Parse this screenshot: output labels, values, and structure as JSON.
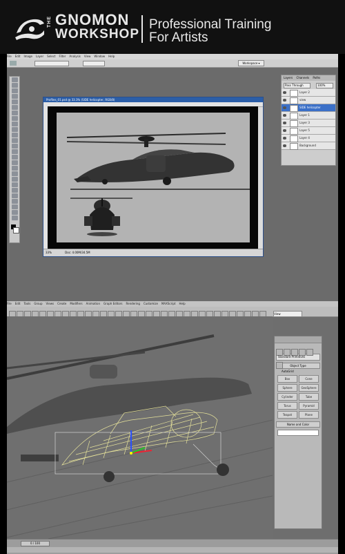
{
  "banner": {
    "logo_the": "THE",
    "logo_line1": "GNOMON",
    "logo_line2": "WORKSHOP",
    "tagline_line1": "Professional Training",
    "tagline_line2": "For Artists"
  },
  "photoshop": {
    "menu": [
      "File",
      "Edit",
      "Image",
      "Layer",
      "Select",
      "Filter",
      "Analysis",
      "View",
      "Window",
      "Help"
    ],
    "workspace_button": "Workspace ▾",
    "document_title": "Profiles_01.psd @ 33.3% (SIDE helicopter, RGB/8)",
    "zoom": "33%",
    "doc_info": "Doc: 4.00M/34.5M",
    "layers_panel": {
      "tabs": [
        "Layers",
        "Channels",
        "Paths"
      ],
      "blend_mode": "Pass Through",
      "opacity": "100%",
      "layers": [
        {
          "name": "Layer 2",
          "selected": false
        },
        {
          "name": "view",
          "selected": false
        },
        {
          "name": "SIDE helicopter",
          "selected": true
        },
        {
          "name": "Layer 1",
          "selected": false
        },
        {
          "name": "Layer 3",
          "selected": false
        },
        {
          "name": "Layer 5",
          "selected": false
        },
        {
          "name": "Layer 4",
          "selected": false
        },
        {
          "name": "Background",
          "selected": false
        }
      ]
    }
  },
  "max": {
    "menu": [
      "File",
      "Edit",
      "Tools",
      "Group",
      "Views",
      "Create",
      "Modifiers",
      "Animation",
      "Graph Editors",
      "Rendering",
      "Customize",
      "MAXScript",
      "Help"
    ],
    "view_dropdown": "View",
    "command_panel": {
      "object_category": "Standard Primitives",
      "rollout_object_type": "Object Type",
      "autogrid_label": "AutoGrid",
      "buttons": [
        "Box",
        "Cone",
        "Sphere",
        "GeoSphere",
        "Cylinder",
        "Tube",
        "Torus",
        "Pyramid",
        "Teapot",
        "Plane"
      ],
      "rollout_name_color": "Name and Color"
    },
    "timeline": "0 / 100"
  },
  "colors": {
    "banner_bg": "#111111",
    "ps_bg": "#6b6b6b",
    "selection_blue": "#3b70c8",
    "max_bg": "#6e6e6e"
  }
}
